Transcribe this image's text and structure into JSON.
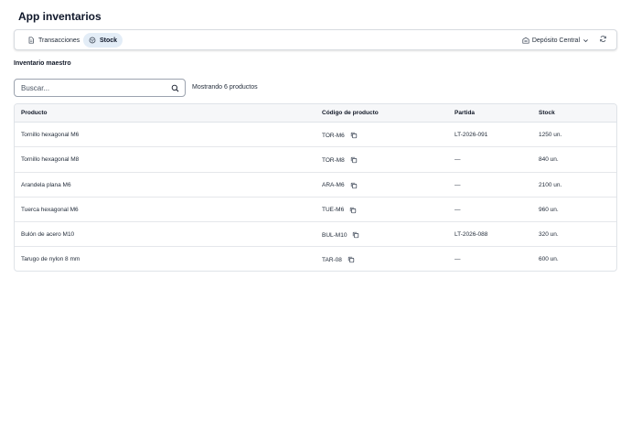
{
  "app": {
    "title": "App inventarios"
  },
  "toolbar": {
    "tabs": [
      {
        "label": "Transacciones",
        "icon": "document-icon",
        "active": false
      },
      {
        "label": "Stock",
        "icon": "box-icon",
        "active": true
      }
    ],
    "depot_label": "Depósito Central",
    "depot_icon": "warehouse-icon",
    "refresh_icon": "refresh-icon"
  },
  "section": {
    "title": "Inventario maestro"
  },
  "search": {
    "placeholder": "Buscar...",
    "value": "",
    "count_text": "Mostrando 6 productos"
  },
  "table": {
    "headers": [
      "Producto",
      "Código de producto",
      "Partida",
      "Stock"
    ],
    "rows": [
      {
        "product": "Tornillo hexagonal M6",
        "code": "TOR-M6",
        "batch": "LT-2026-091",
        "stock": "1250 un."
      },
      {
        "product": "Tornillo hexagonal M8",
        "code": "TOR-M8",
        "batch": "—",
        "stock": "840 un."
      },
      {
        "product": "Arandela plana M6",
        "code": "ARA-M6",
        "batch": "—",
        "stock": "2100 un."
      },
      {
        "product": "Tuerca hexagonal M6",
        "code": "TUE-M6",
        "batch": "—",
        "stock": "960 un."
      },
      {
        "product": "Bulón de acero M10",
        "code": "BUL-M10",
        "batch": "LT-2026-088",
        "stock": "320 un."
      },
      {
        "product": "Tarugo de nylon 8 mm",
        "code": "TAR-08",
        "batch": "—",
        "stock": "600 un."
      }
    ]
  },
  "colors": {
    "active_tab_bg": "#e3edf7",
    "header_bg": "#f6f7f9",
    "border": "#dfe3e8"
  }
}
